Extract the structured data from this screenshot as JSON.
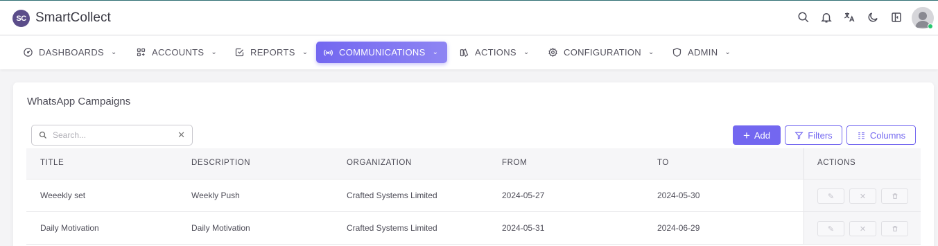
{
  "app": {
    "logo_text": "SC",
    "brand": "SmartCollect"
  },
  "header_icons": [
    "search-icon",
    "bell-icon",
    "translate-icon",
    "moon-icon",
    "layout-icon",
    "user-avatar"
  ],
  "nav": [
    {
      "label": "DASHBOARDS",
      "icon": "dashboard-icon",
      "active": false
    },
    {
      "label": "ACCOUNTS",
      "icon": "apps-icon",
      "active": false
    },
    {
      "label": "REPORTS",
      "icon": "checkbox-icon",
      "active": false
    },
    {
      "label": "COMMUNICATIONS",
      "icon": "broadcast-icon",
      "active": true
    },
    {
      "label": "ACTIONS",
      "icon": "books-icon",
      "active": false
    },
    {
      "label": "CONFIGURATION",
      "icon": "gear-icon",
      "active": false
    },
    {
      "label": "ADMIN",
      "icon": "shield-icon",
      "active": false
    }
  ],
  "page": {
    "title": "WhatsApp Campaigns",
    "search_placeholder": "Search...",
    "add_label": "Add",
    "filters_label": "Filters",
    "columns_label": "Columns"
  },
  "table": {
    "headers": [
      "TITLE",
      "DESCRIPTION",
      "ORGANIZATION",
      "FROM",
      "TO",
      "ACTIONS"
    ],
    "rows": [
      [
        "Weeekly set",
        "Weekly Push",
        "Crafted Systems Limited",
        "2024-05-27",
        "2024-05-30"
      ],
      [
        "Daily Motivation",
        "Daily Motivation",
        "Crafted Systems Limited",
        "2024-05-31",
        "2024-06-29"
      ]
    ]
  },
  "colors": {
    "accent": "#7367f0",
    "online": "#28c76f"
  }
}
